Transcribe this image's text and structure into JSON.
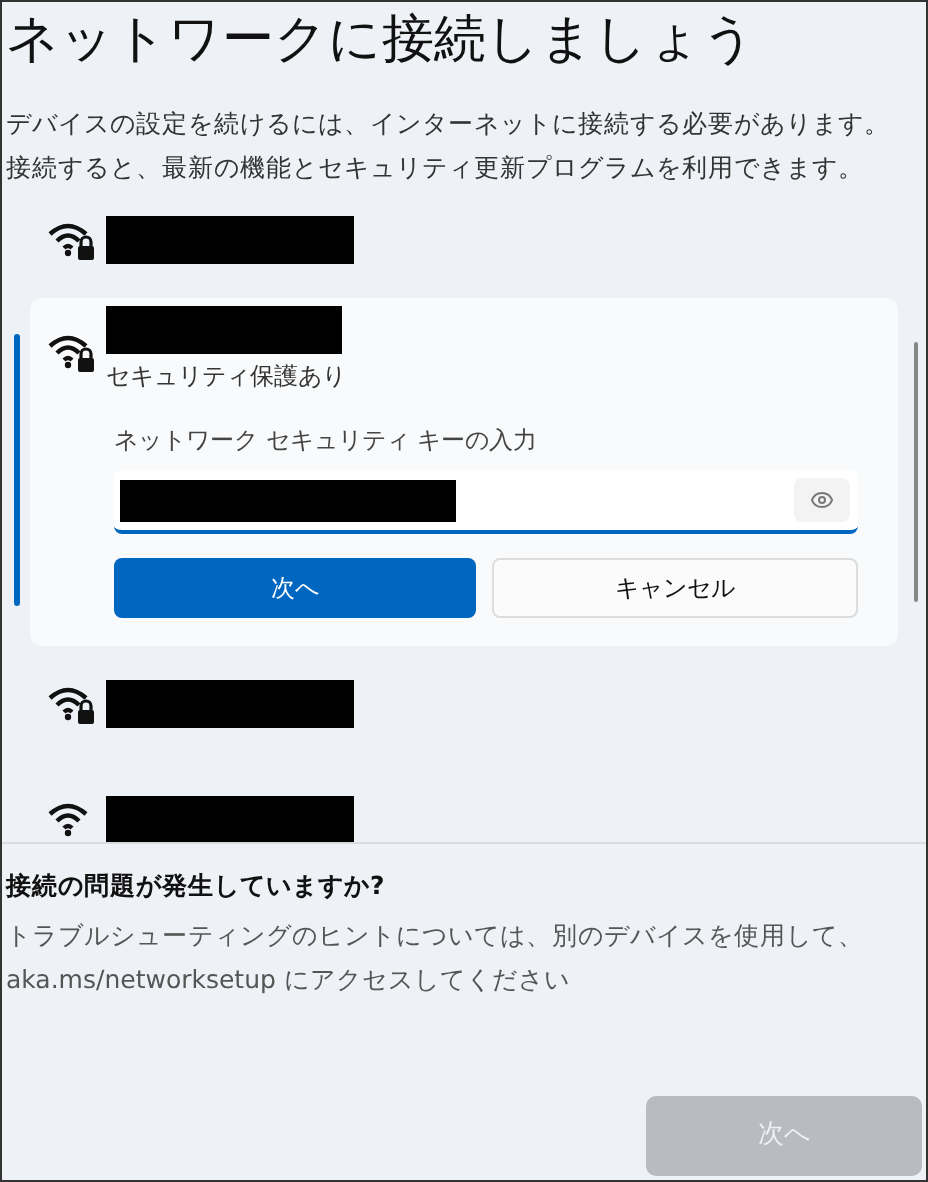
{
  "title": "ネットワークに接続しましょう",
  "description": "デバイスの設定を続けるには、インターネットに接続する必要があります。接続すると、最新の機能とセキュリティ更新プログラムを利用できます。",
  "networks": [
    {
      "kind": "collapsed",
      "secured": true,
      "name_redacted": true,
      "selected": false
    },
    {
      "kind": "expanded",
      "secured": true,
      "name_redacted": true,
      "selected": true,
      "status": "セキュリティ保護あり",
      "field": {
        "label": "ネットワーク セキュリティ キーの入力",
        "value_redacted": true
      },
      "buttons": [
        {
          "label": "次へ",
          "primary": true
        },
        {
          "label": "キャンセル",
          "primary": false
        }
      ]
    },
    {
      "kind": "collapsed",
      "secured": true,
      "name_redacted": true,
      "selected": false
    },
    {
      "kind": "collapsed",
      "secured": false,
      "name_redacted": true,
      "selected": false
    }
  ],
  "help": {
    "heading": "接続の問題が発生していますか?",
    "text": "トラブルシューティングのヒントについては、別のデバイスを使用して、aka.ms/networksetup にアクセスしてください"
  },
  "footer_button": {
    "label": "次へ",
    "disabled": true
  }
}
